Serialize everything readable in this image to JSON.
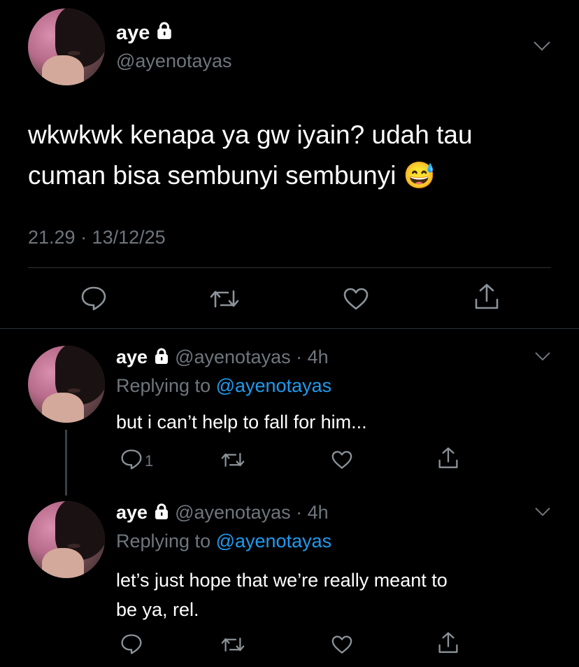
{
  "main_tweet": {
    "display_name": "aye",
    "handle": "@ayenotayas",
    "text_line1": "wkwkwk kenapa ya gw iyain? udah tau",
    "text_line2": "cuman bisa sembunyi sembunyi",
    "emoji": "😅",
    "timestamp": "21.29 · 13/12/25"
  },
  "replies": [
    {
      "display_name": "aye",
      "handle_time": "@ayenotayas · 4h",
      "replying_prefix": "Replying to ",
      "replying_to": "@ayenotayas",
      "text_line1": "but i can’t help to fall for him...",
      "text_line2": "",
      "reply_count": "1"
    },
    {
      "display_name": "aye",
      "handle_time": "@ayenotayas · 4h",
      "replying_prefix": "Replying to ",
      "replying_to": "@ayenotayas",
      "text_line1": "let’s just hope that we’re really meant to",
      "text_line2": "be ya, rel.",
      "reply_count": ""
    }
  ],
  "colors": {
    "background": "#000000",
    "muted": "#6e767d",
    "link": "#1d9bf0",
    "divider": "#2f3336"
  }
}
